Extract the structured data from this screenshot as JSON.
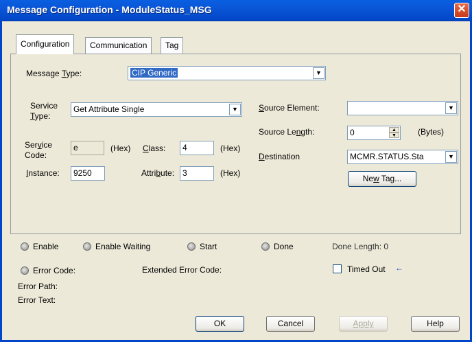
{
  "window": {
    "title": "Message Configuration - ModuleStatus_MSG",
    "close_glyph": "✕"
  },
  "tabs": [
    {
      "label": "Configuration",
      "active": true
    },
    {
      "label": "Communication",
      "active": false
    },
    {
      "label": "Tag",
      "active": false
    }
  ],
  "config": {
    "message_type": {
      "pre": "Message ",
      "u": "T",
      "post": "ype:",
      "value": "CIP Generic"
    },
    "service_type": {
      "line1": "Service",
      "u": "T",
      "line2": "ype:",
      "value": "Get Attribute Single"
    },
    "service_code": {
      "line1_pre": "Ser",
      "u": "v",
      "line1_post": "ice",
      "line2": "Code:",
      "value": "e",
      "unit": "(Hex)"
    },
    "class": {
      "u": "C",
      "post": "lass:",
      "value": "4",
      "unit": "(Hex)"
    },
    "instance": {
      "u": "I",
      "post": "nstance:",
      "value": "9250"
    },
    "attribute": {
      "pre": "Attri",
      "u": "b",
      "post": "ute:",
      "value": "3",
      "unit": "(Hex)"
    },
    "source_element": {
      "u": "S",
      "post": "ource Element:",
      "value": ""
    },
    "source_length": {
      "pre": "Source Le",
      "u": "n",
      "post": "gth:",
      "value": "0",
      "unit": "(Bytes)"
    },
    "destination": {
      "u": "D",
      "post": "estination",
      "value": "MCMR.STATUS.Sta"
    },
    "new_tag": {
      "pre": "Ne",
      "u": "w",
      "post": " Tag..."
    }
  },
  "status": {
    "enable": "Enable",
    "enable_waiting": "Enable Waiting",
    "start": "Start",
    "done": "Done",
    "done_length": "Done Length: 0",
    "error_code": "Error Code:",
    "extended_error_code": "Extended Error Code:",
    "timed_out": "Timed Out",
    "timed_out_arrow": "←",
    "error_path": "Error Path:",
    "error_text": "Error Text:"
  },
  "buttons": {
    "ok": "OK",
    "cancel": "Cancel",
    "apply": "Apply",
    "help": "Help"
  },
  "colors": {
    "titlebar": "#0a5fe0",
    "selection": "#316ac5",
    "arrow": "#1b4fd6"
  },
  "icons": [
    "close-icon",
    "dropdown-arrow-icon",
    "spin-up-icon",
    "spin-down-icon",
    "left-arrow-icon"
  ]
}
